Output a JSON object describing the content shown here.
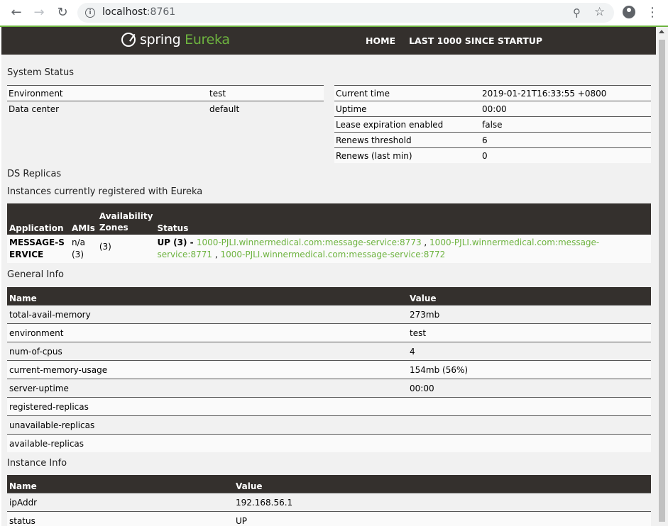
{
  "browser": {
    "url_host": "localhost",
    "url_port": ":8761",
    "icons": [
      "back-icon",
      "forward-icon",
      "reload-icon",
      "info-icon",
      "zoom-icon",
      "star-icon",
      "profile-icon",
      "menu-icon"
    ]
  },
  "navbar": {
    "brand_spring": "spring",
    "brand_eureka": "Eureka",
    "links": [
      "HOME",
      "LAST 1000 SINCE STARTUP"
    ]
  },
  "system_status": {
    "title": "System Status",
    "left": [
      {
        "label": "Environment",
        "value": "test"
      },
      {
        "label": "Data center",
        "value": "default"
      }
    ],
    "right": [
      {
        "label": "Current time",
        "value": "2019-01-21T16:33:55 +0800"
      },
      {
        "label": "Uptime",
        "value": "00:00"
      },
      {
        "label": "Lease expiration enabled",
        "value": "false"
      },
      {
        "label": "Renews threshold",
        "value": "6"
      },
      {
        "label": "Renews (last min)",
        "value": "0"
      }
    ]
  },
  "ds_replicas": {
    "title": "DS Replicas"
  },
  "instances": {
    "title": "Instances currently registered with Eureka",
    "headers": [
      "Application",
      "AMIs",
      "Availability Zones",
      "Status"
    ],
    "row": {
      "application": "MESSAGE-SERVICE",
      "amis": "n/a (3)",
      "zones": "(3)",
      "status_prefix": "UP (3) - ",
      "links": [
        "1000-PJLI.winnermedical.com:message-service:8773",
        "1000-PJLI.winnermedical.com:message-service:8771",
        "1000-PJLI.winnermedical.com:message-service:8772"
      ],
      "separator": " , "
    }
  },
  "general_info": {
    "title": "General Info",
    "headers": [
      "Name",
      "Value"
    ],
    "rows": [
      {
        "name": "total-avail-memory",
        "value": "273mb"
      },
      {
        "name": "environment",
        "value": "test"
      },
      {
        "name": "num-of-cpus",
        "value": "4"
      },
      {
        "name": "current-memory-usage",
        "value": "154mb (56%)"
      },
      {
        "name": "server-uptime",
        "value": "00:00"
      },
      {
        "name": "registered-replicas",
        "value": ""
      },
      {
        "name": "unavailable-replicas",
        "value": ""
      },
      {
        "name": "available-replicas",
        "value": ""
      }
    ]
  },
  "instance_info": {
    "title": "Instance Info",
    "headers": [
      "Name",
      "Value"
    ],
    "rows": [
      {
        "name": "ipAddr",
        "value": "192.168.56.1"
      },
      {
        "name": "status",
        "value": "UP"
      }
    ]
  }
}
